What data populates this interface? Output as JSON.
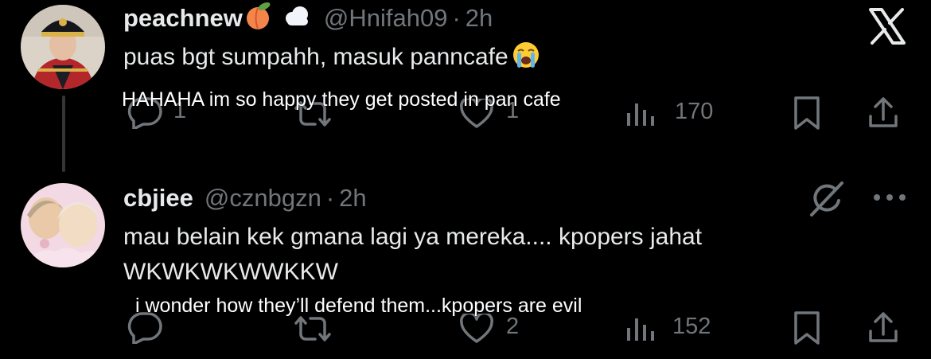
{
  "colors": {
    "background": "#000000",
    "text": "#e7e9ea",
    "muted": "#71767b",
    "thread_line": "#333639"
  },
  "top_right": {
    "icon": "x-logo-icon"
  },
  "tweets": [
    {
      "display_name": "peachnew",
      "emojis": [
        "peach-emoji",
        "cloud-emoji"
      ],
      "handle": "@Hnifah09",
      "dot": "·",
      "time": "2h",
      "text": "puas bgt sumpahh, masuk panncafe",
      "text_emoji": "crying-face-emoji",
      "translation": "HAHAHA im so happy they get posted in pan cafe",
      "stats": {
        "replies": "1",
        "likes": "1",
        "views": "170"
      }
    },
    {
      "display_name": "cbjiee",
      "handle": "@cznbgzn",
      "dot": "·",
      "time": "2h",
      "text_line1": "mau belain kek gmana lagi ya mereka.... kpopers jahat",
      "text_line2": "WKWKWKWWKKW",
      "translation": "i wonder how they’ll defend them...kpopers are evil",
      "stats": {
        "likes": "2",
        "views": "152"
      }
    }
  ]
}
